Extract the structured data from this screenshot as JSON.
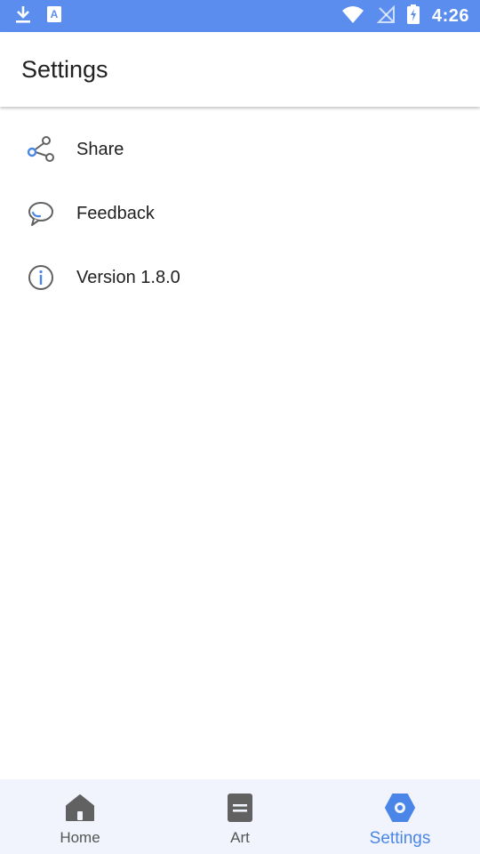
{
  "status_bar": {
    "time": "4:26",
    "icons": [
      "download-icon",
      "text-a-icon",
      "wifi-icon",
      "no-signal-icon",
      "battery-charging-icon"
    ]
  },
  "app_bar": {
    "title": "Settings"
  },
  "settings": {
    "items": [
      {
        "label": "Share",
        "icon": "share-icon"
      },
      {
        "label": "Feedback",
        "icon": "feedback-icon"
      },
      {
        "label": "Version 1.8.0",
        "icon": "info-icon"
      }
    ]
  },
  "bottom_nav": {
    "items": [
      {
        "label": "Home",
        "icon": "home-icon",
        "active": false
      },
      {
        "label": "Art",
        "icon": "art-icon",
        "active": false
      },
      {
        "label": "Settings",
        "icon": "settings-icon",
        "active": true
      }
    ]
  },
  "colors": {
    "status_bar": "#5b8def",
    "accent": "#4a86e8",
    "nav_background": "#f1f4fc",
    "icon_gray": "#616161"
  }
}
